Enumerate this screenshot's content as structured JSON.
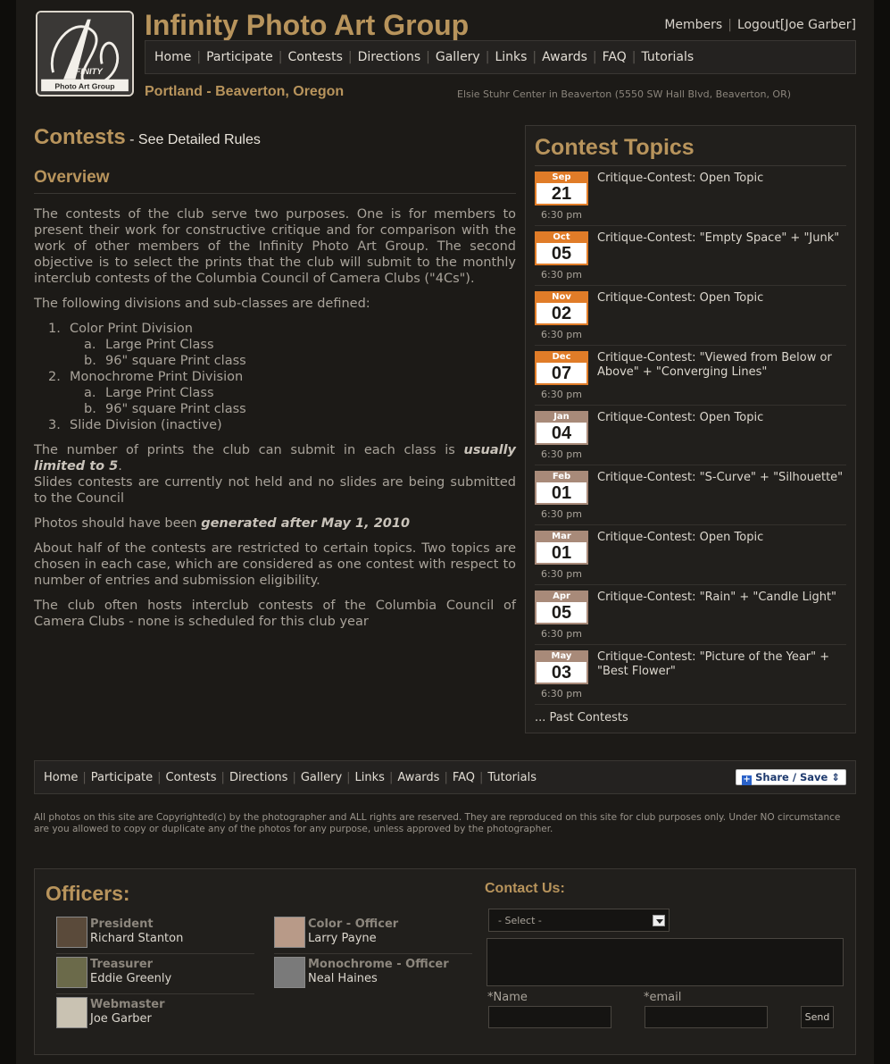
{
  "header": {
    "site_title": "Infinity Photo Art Group",
    "logo_text_top": "INFINITY",
    "logo_text_bottom": "Photo Art Group",
    "location": "Portland - Beaverton, Oregon",
    "address": "Elsie Stuhr Center in Beaverton (5550 SW Hall Blvd, Beaverton, OR)",
    "members_label": "Members",
    "logout_label": "Logout",
    "user_label": "[Joe Garber]"
  },
  "nav": [
    "Home",
    "Participate",
    "Contests",
    "Directions",
    "Gallery",
    "Links",
    "Awards",
    "FAQ",
    "Tutorials"
  ],
  "main": {
    "heading": "Contests",
    "rules_link": " - See Detailed Rules",
    "overview_heading": "Overview",
    "p1": "The contests of the club serve two purposes. One is for members to present their work for constructive critique and for comparison with the work of other members of the Infinity Photo Art Group. The second objective is to select the prints that the club will submit to the monthly interclub contests of the Columbia Council of Camera Clubs (\"4Cs\").",
    "p2": "The following divisions and sub-classes are defined:",
    "divisions": [
      {
        "num": "1.",
        "label": "Color Print Division",
        "subs": [
          {
            "let": "a.",
            "label": "Large Print Class"
          },
          {
            "let": "b.",
            "label": "96\" square Print class"
          }
        ]
      },
      {
        "num": "2.",
        "label": "Monochrome Print Division",
        "subs": [
          {
            "let": "a.",
            "label": "Large Print Class"
          },
          {
            "let": "b.",
            "label": "96\" square Print class"
          }
        ]
      },
      {
        "num": "3.",
        "label": "Slide Division (inactive)",
        "subs": []
      }
    ],
    "p3_a": "The number of prints the club can submit in each class is ",
    "p3_em": "usually limited to 5",
    "p3_b": ".",
    "p3_c": "Slides contests are currently not held and no slides are being submitted to the Council",
    "p4_a": "Photos should have been ",
    "p4_em": "generated after May 1, 2010",
    "p5": "About half of the contests are restricted to certain topics. Two topics are chosen in each case, which are considered as one contest with respect to number of entries and submission eligibility.",
    "p6": "The club often hosts interclub contests of the Columbia Council of Camera Clubs - none is scheduled for this club year"
  },
  "sidebar": {
    "heading": "Contest Topics",
    "topics": [
      {
        "month": "Sep",
        "day": "21",
        "time": "6:30 pm",
        "title": "Critique-Contest: Open Topic"
      },
      {
        "month": "Oct",
        "day": "05",
        "time": "6:30 pm",
        "title": "Critique-Contest: \"Empty Space\" + \"Junk\""
      },
      {
        "month": "Nov",
        "day": "02",
        "time": "6:30 pm",
        "title": "Critique-Contest: Open Topic"
      },
      {
        "month": "Dec",
        "day": "07",
        "time": "6:30 pm",
        "title": "Critique-Contest: \"Viewed from Below or Above\" + \"Converging Lines\""
      },
      {
        "month": "Jan",
        "day": "04",
        "time": "6:30 pm",
        "title": "Critique-Contest: Open Topic"
      },
      {
        "month": "Feb",
        "day": "01",
        "time": "6:30 pm",
        "title": "Critique-Contest: \"S-Curve\" + \"Silhouette\""
      },
      {
        "month": "Mar",
        "day": "01",
        "time": "6:30 pm",
        "title": "Critique-Contest: Open Topic"
      },
      {
        "month": "Apr",
        "day": "05",
        "time": "6:30 pm",
        "title": "Critique-Contest: \"Rain\" + \"Candle Light\""
      },
      {
        "month": "May",
        "day": "03",
        "time": "6:30 pm",
        "title": "Critique-Contest: \"Picture of the Year\" + \"Best Flower\""
      }
    ],
    "past_link": "... Past Contests"
  },
  "footer": {
    "share_label": "Share / Save",
    "copyright": "All photos on this site are Copyrighted(c) by the photographer and ALL rights are reserved. They are reproduced on this site for club purposes only. Under NO circumstance are you allowed to copy or duplicate any of the photos for any purpose, unless approved by the photographer."
  },
  "officers": {
    "heading": "Officers:",
    "list": [
      {
        "role": "President",
        "name": "Richard Stanton"
      },
      {
        "role": "Treasurer",
        "name": "Eddie Greenly"
      },
      {
        "role": "Webmaster",
        "name": "Joe Garber"
      },
      {
        "role": "Color - Officer",
        "name": "Larry Payne"
      },
      {
        "role": "Monochrome - Officer",
        "name": "Neal Haines"
      }
    ]
  },
  "contact": {
    "heading": "Contact Us:",
    "select_value": "- Select -",
    "name_label": "*Name",
    "email_label": "*email",
    "send_label": "Send"
  },
  "colors": {
    "accent": "#b8945c",
    "calendar_upcoming": "#e07c28",
    "calendar_later": "#a88a79",
    "background": "#1c1a17"
  }
}
